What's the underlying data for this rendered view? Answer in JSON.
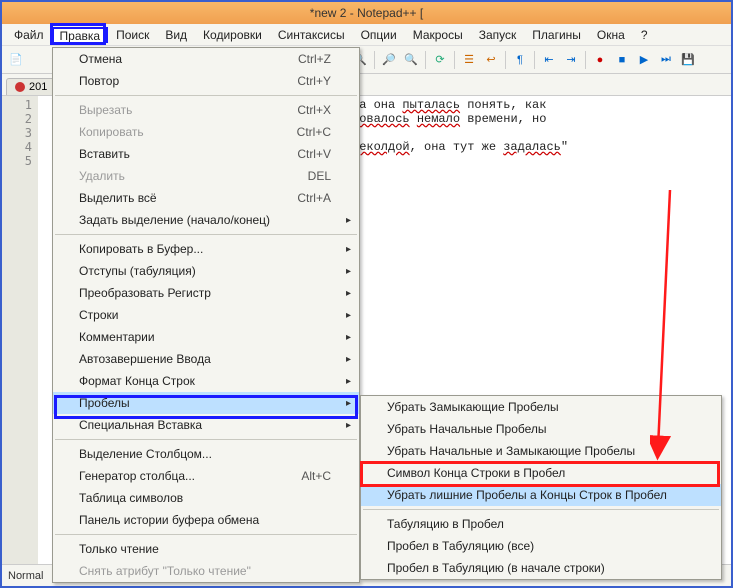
{
  "window": {
    "title": "*new  2 - Notepad++ ["
  },
  "menubar": {
    "items": [
      "Файл",
      "Правка",
      "Поиск",
      "Вид",
      "Кодировки",
      "Синтаксисы",
      "Опции",
      "Макросы",
      "Запуск",
      "Плагины",
      "Окна",
      "?"
    ]
  },
  "tab": {
    "label": "201"
  },
  "gutter": {
    "lines": [
      "1",
      "2",
      "3",
      "4",
      "5"
    ]
  },
  "editor_lines": {
    "l1a": "да она ",
    "l1b": "пыталась",
    "l1c": " понять, как ",
    "l2": "",
    "l3a": "бовалось",
    "l3b": " ",
    "l3c": "немало",
    "l3d": " времени, но ",
    "l4": "",
    "l5a": "щеколдой",
    "l5b": ", она тут же ",
    "l5c": "задалась",
    "l5d": "\""
  },
  "status": {
    "mode": "Normal"
  },
  "menu_edit": {
    "undo": {
      "label": "Отмена",
      "sc": "Ctrl+Z"
    },
    "redo": {
      "label": "Повтор",
      "sc": "Ctrl+Y"
    },
    "cut": {
      "label": "Вырезать",
      "sc": "Ctrl+X"
    },
    "copy": {
      "label": "Копировать",
      "sc": "Ctrl+C"
    },
    "paste": {
      "label": "Вставить",
      "sc": "Ctrl+V"
    },
    "delete": {
      "label": "Удалить",
      "sc": "DEL"
    },
    "selall": {
      "label": "Выделить всё",
      "sc": "Ctrl+A"
    },
    "setsel": {
      "label": "Задать выделение (начало/конец)"
    },
    "copybuf": {
      "label": "Копировать в Буфер..."
    },
    "indent": {
      "label": "Отступы (табуляция)"
    },
    "case": {
      "label": "Преобразовать Регистр"
    },
    "lines": {
      "label": "Строки"
    },
    "comment": {
      "label": "Комментарии"
    },
    "auto": {
      "label": "Автозавершение Ввода"
    },
    "eol": {
      "label": "Формат Конца Строк"
    },
    "spaces": {
      "label": "Пробелы"
    },
    "pastesp": {
      "label": "Специальная Вставка"
    },
    "colsel": {
      "label": "Выделение Столбцом..."
    },
    "colgen": {
      "label": "Генератор столбца...",
      "sc": "Alt+C"
    },
    "charmap": {
      "label": "Таблица символов"
    },
    "cliphist": {
      "label": "Панель истории буфера обмена"
    },
    "readonly": {
      "label": "Только чтение"
    },
    "clearro": {
      "label": "Снять атрибут \"Только чтение\""
    }
  },
  "menu_spaces": {
    "trim_trail": "Убрать Замыкающие Пробелы",
    "trim_lead": "Убрать Начальные Пробелы",
    "trim_both": "Убрать Начальные и Замыкающие Пробелы",
    "eol_to_sp": "Символ Конца Строки в Пробел",
    "collapse": "Убрать лишние Пробелы а Концы Строк в Пробел",
    "tab_to_sp": "Табуляцию в Пробел",
    "sp_to_tab_all": "Пробел в Табуляцию (все)",
    "sp_to_tab_lead": "Пробел в Табуляцию (в начале строки)"
  }
}
